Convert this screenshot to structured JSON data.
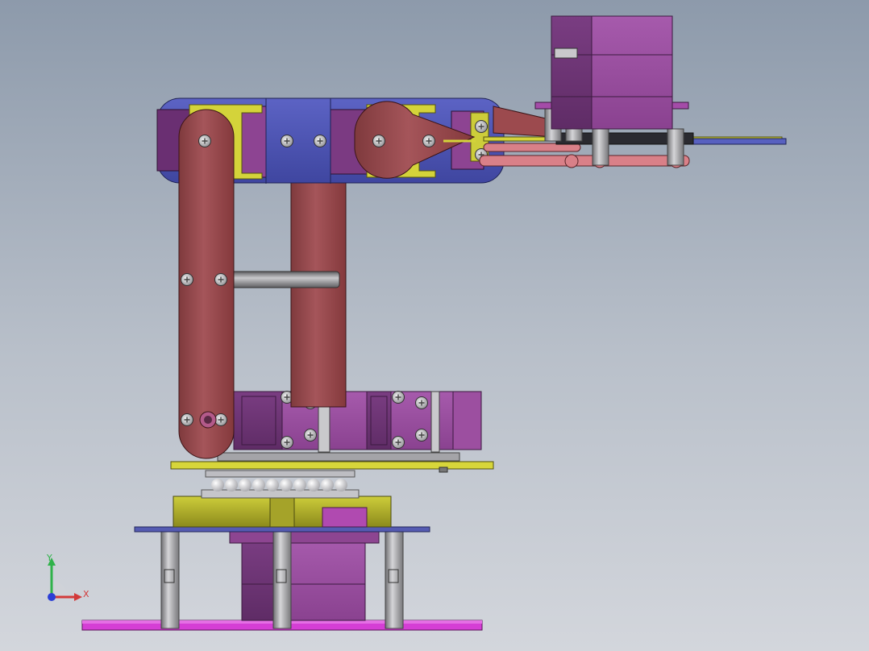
{
  "triad": {
    "x_label": "X",
    "y_label": "Y",
    "x_color": "#d23a3a",
    "y_color": "#2fb24a",
    "z_color": "#2b3fd6"
  },
  "colors": {
    "background_top": "#8d9aab",
    "background_bottom": "#d3d6dc",
    "link_red": "#9b4b4e",
    "servo_purple": "#9a4e9e",
    "bracket_blue": "#4d56b4",
    "plate_yellow": "#d7d63a",
    "base_magenta": "#d53ed5",
    "standoff_gray": "#a3a3a6"
  }
}
